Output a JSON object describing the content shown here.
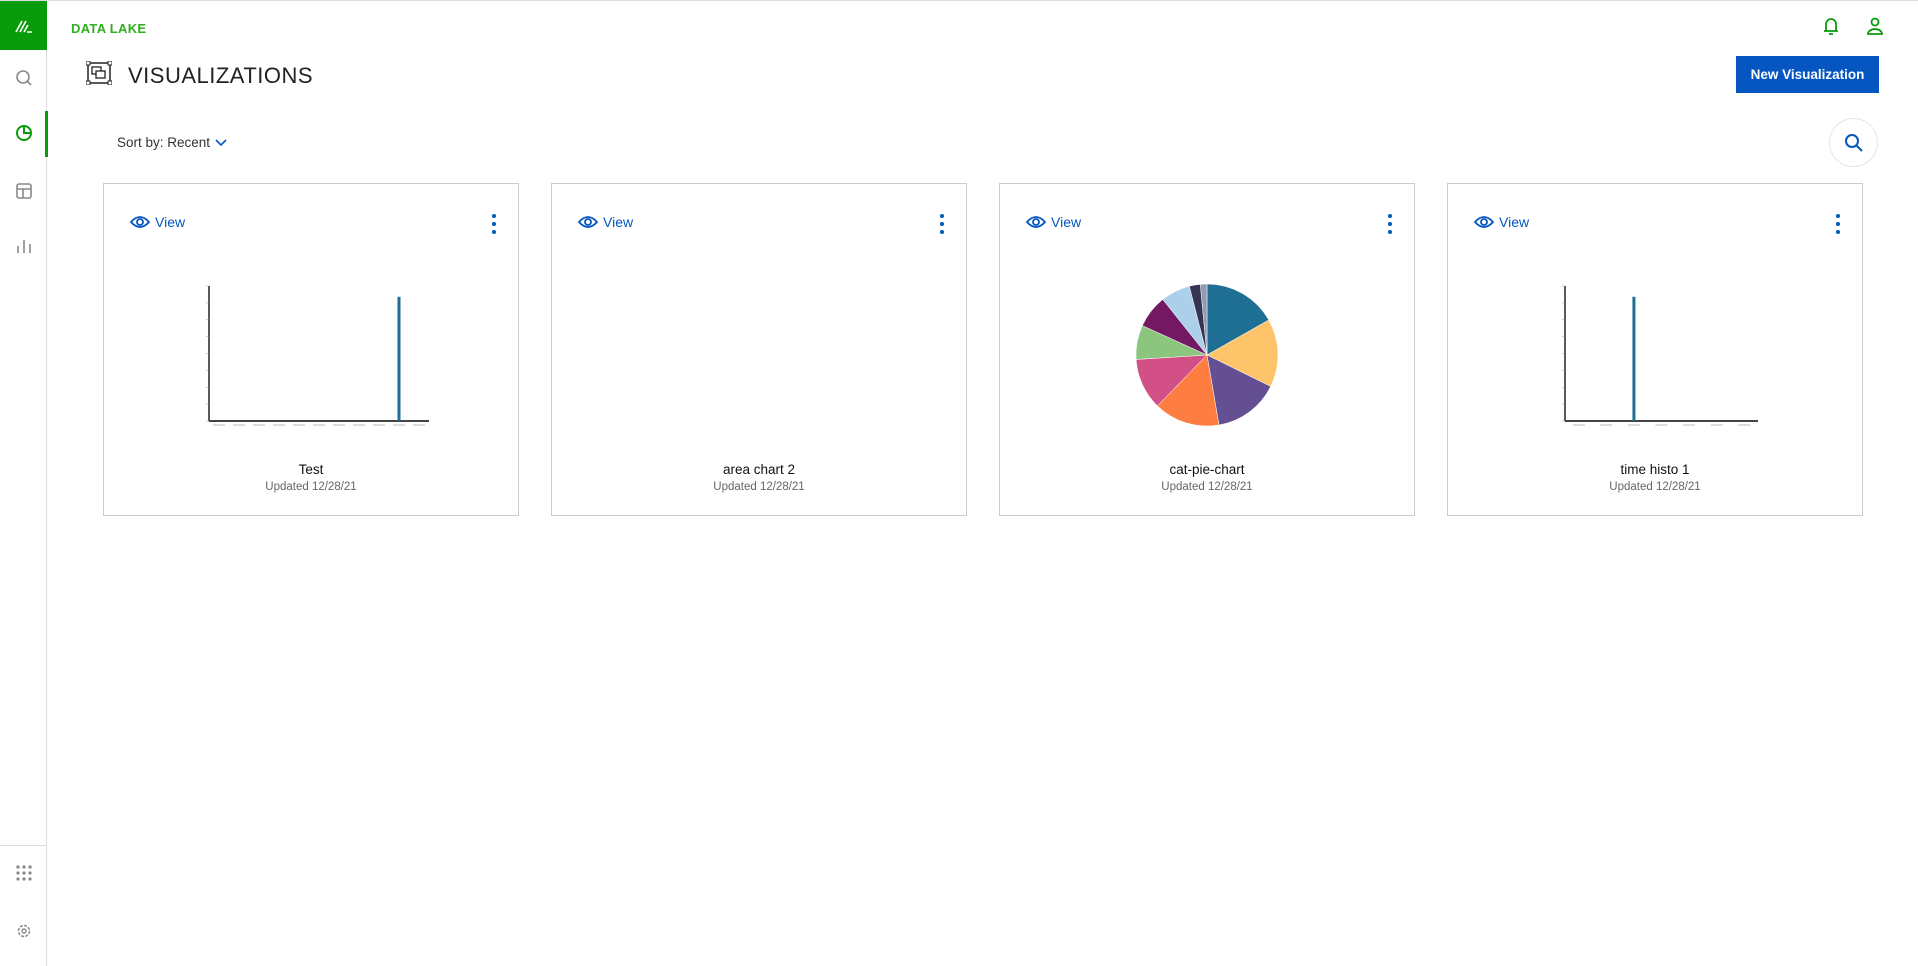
{
  "app": {
    "brand": "DATA LAKE",
    "page_title": "VISUALIZATIONS",
    "new_button": "New Visualization",
    "sort_label": "Sort by: Recent"
  },
  "sidebar": {
    "items": [
      {
        "icon": "logo-icon"
      },
      {
        "icon": "search-icon"
      },
      {
        "icon": "pie-chart-icon",
        "active": true
      },
      {
        "icon": "layout-icon"
      },
      {
        "icon": "bar-chart-icon"
      },
      {
        "icon": "apps-grid-icon"
      },
      {
        "icon": "gear-icon"
      }
    ]
  },
  "colors": {
    "brand_green": "#0a9b0a",
    "accent_blue": "#0556c0",
    "bar": "#1f6f94"
  },
  "cards": [
    {
      "view": "View",
      "title": "Test",
      "updated": "Updated 12/28/21"
    },
    {
      "view": "View",
      "title": "area chart 2",
      "updated": "Updated 12/28/21"
    },
    {
      "view": "View",
      "title": "cat-pie-chart",
      "updated": "Updated 12/28/21"
    },
    {
      "view": "View",
      "title": "time histo 1",
      "updated": "Updated 12/28/21"
    }
  ],
  "chart_data": [
    {
      "type": "bar",
      "bins": 11,
      "values": [
        0,
        0,
        0,
        0,
        0,
        0,
        0,
        0,
        0,
        0.92,
        0
      ],
      "ylim": [
        0,
        1
      ]
    },
    {
      "type": "area",
      "values": []
    },
    {
      "type": "pie",
      "values": [
        16.8,
        15.5,
        15,
        15,
        11.7,
        7.8,
        7.5,
        6.7,
        2.5,
        1.5
      ],
      "colors": [
        "#1f6f94",
        "#fdc46a",
        "#634f91",
        "#fd7e40",
        "#d35087",
        "#8bc57e",
        "#731862",
        "#acd0e9",
        "#363452",
        "#8f9ab3"
      ]
    },
    {
      "type": "bar",
      "bins": 7,
      "values": [
        0,
        0,
        0.92,
        0,
        0,
        0,
        0
      ],
      "ylim": [
        0,
        1
      ]
    }
  ]
}
